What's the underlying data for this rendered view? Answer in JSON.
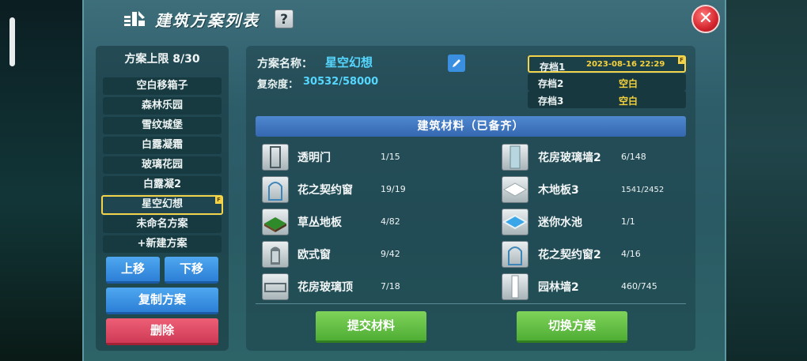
{
  "header": {
    "title": "建筑方案列表",
    "help_label": "?",
    "close_label": "✕"
  },
  "plan_list": {
    "limit_text": "方案上限 8/30",
    "items": [
      {
        "label": "空白移箱子"
      },
      {
        "label": "森林乐园"
      },
      {
        "label": "雪纹城堡"
      },
      {
        "label": "白露凝霜"
      },
      {
        "label": "玻璃花园"
      },
      {
        "label": "白露凝2"
      },
      {
        "label": "星空幻想",
        "selected": true
      },
      {
        "label": "未命名方案"
      },
      {
        "label": "+新建方案"
      }
    ],
    "selected_flag": "F",
    "move_up_label": "上移",
    "move_down_label": "下移",
    "copy_label": "复制方案",
    "delete_label": "删除"
  },
  "detail": {
    "name_label": "方案名称：",
    "name_value": "星空幻想",
    "complexity_label": "复杂度：",
    "complexity_value": "30532/58000",
    "saves": [
      {
        "name": "存档1",
        "value": "2023-08-16 22:29",
        "selected": true
      },
      {
        "name": "存档2",
        "value": "空白"
      },
      {
        "name": "存档3",
        "value": "空白"
      }
    ],
    "save_flag": "F",
    "materials_title": "建筑材料（已备齐）",
    "materials": [
      {
        "name": "透明门",
        "count": "1/15"
      },
      {
        "name": "花房玻璃墙2",
        "count": "6/148"
      },
      {
        "name": "花之契约窗",
        "count": "19/19"
      },
      {
        "name": "木地板3",
        "count": "1541/2452"
      },
      {
        "name": "草丛地板",
        "count": "4/82"
      },
      {
        "name": "迷你水池",
        "count": "1/1"
      },
      {
        "name": "欧式窗",
        "count": "9/42"
      },
      {
        "name": "花之契约窗2",
        "count": "4/16"
      },
      {
        "name": "花房玻璃顶",
        "count": "7/18"
      },
      {
        "name": "园林墙2",
        "count": "460/745"
      }
    ],
    "submit_label": "提交材料",
    "switch_label": "切换方案"
  },
  "colors": {
    "accent_cyan": "#56d7ff",
    "highlight_yellow": "#f3d34a",
    "button_blue": "#2c7fd6",
    "button_red": "#cf3a55",
    "button_green": "#4fae35"
  }
}
